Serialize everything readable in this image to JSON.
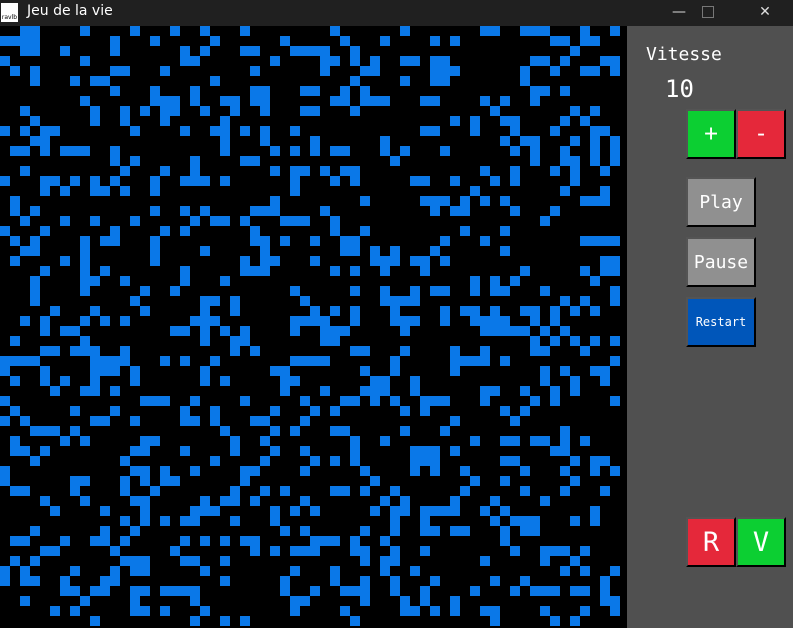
{
  "window": {
    "title": "Jeu de la vie",
    "icon_label": "ravlb",
    "controls": {
      "minimize": "—",
      "maximize": "□",
      "close": "✕"
    }
  },
  "panel": {
    "speed_label": "Vitesse",
    "speed_value": "10",
    "buttons": {
      "plus": "+",
      "minus": "-",
      "play": "Play",
      "pause": "Pause",
      "restart": "Restart",
      "r": "R",
      "v": "V"
    }
  },
  "colors": {
    "alive": "#0a78e8",
    "grid_background": "#000000",
    "panel_background": "#505050",
    "plus": "#0ccf32",
    "minus": "#e5283a",
    "play": "#909090",
    "restart": "#0056ba"
  },
  "grid": {
    "columns": 62,
    "rows": 60,
    "cell_size_px": 10,
    "alive_density": 0.24,
    "seed": 17
  }
}
